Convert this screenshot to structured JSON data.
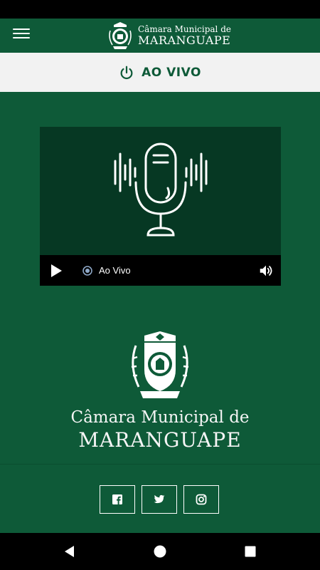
{
  "header": {
    "menu_icon": "hamburger-icon",
    "logo_line1": "Câmara Municipal de",
    "logo_line2": "MARANGUAPE"
  },
  "live_bar": {
    "icon": "power-icon",
    "label": "AO VIVO"
  },
  "player": {
    "art_icon": "microphone-icon",
    "status": "Ao Vivo"
  },
  "brand": {
    "line1": "Câmara Municipal de",
    "line2": "MARANGUAPE"
  },
  "social": {
    "buttons": [
      "facebook-icon",
      "twitter-icon",
      "instagram-icon"
    ]
  },
  "colors": {
    "primary": "#0e5a38",
    "player_bg": "#063823",
    "live_bar_bg": "#f2f2f2"
  }
}
